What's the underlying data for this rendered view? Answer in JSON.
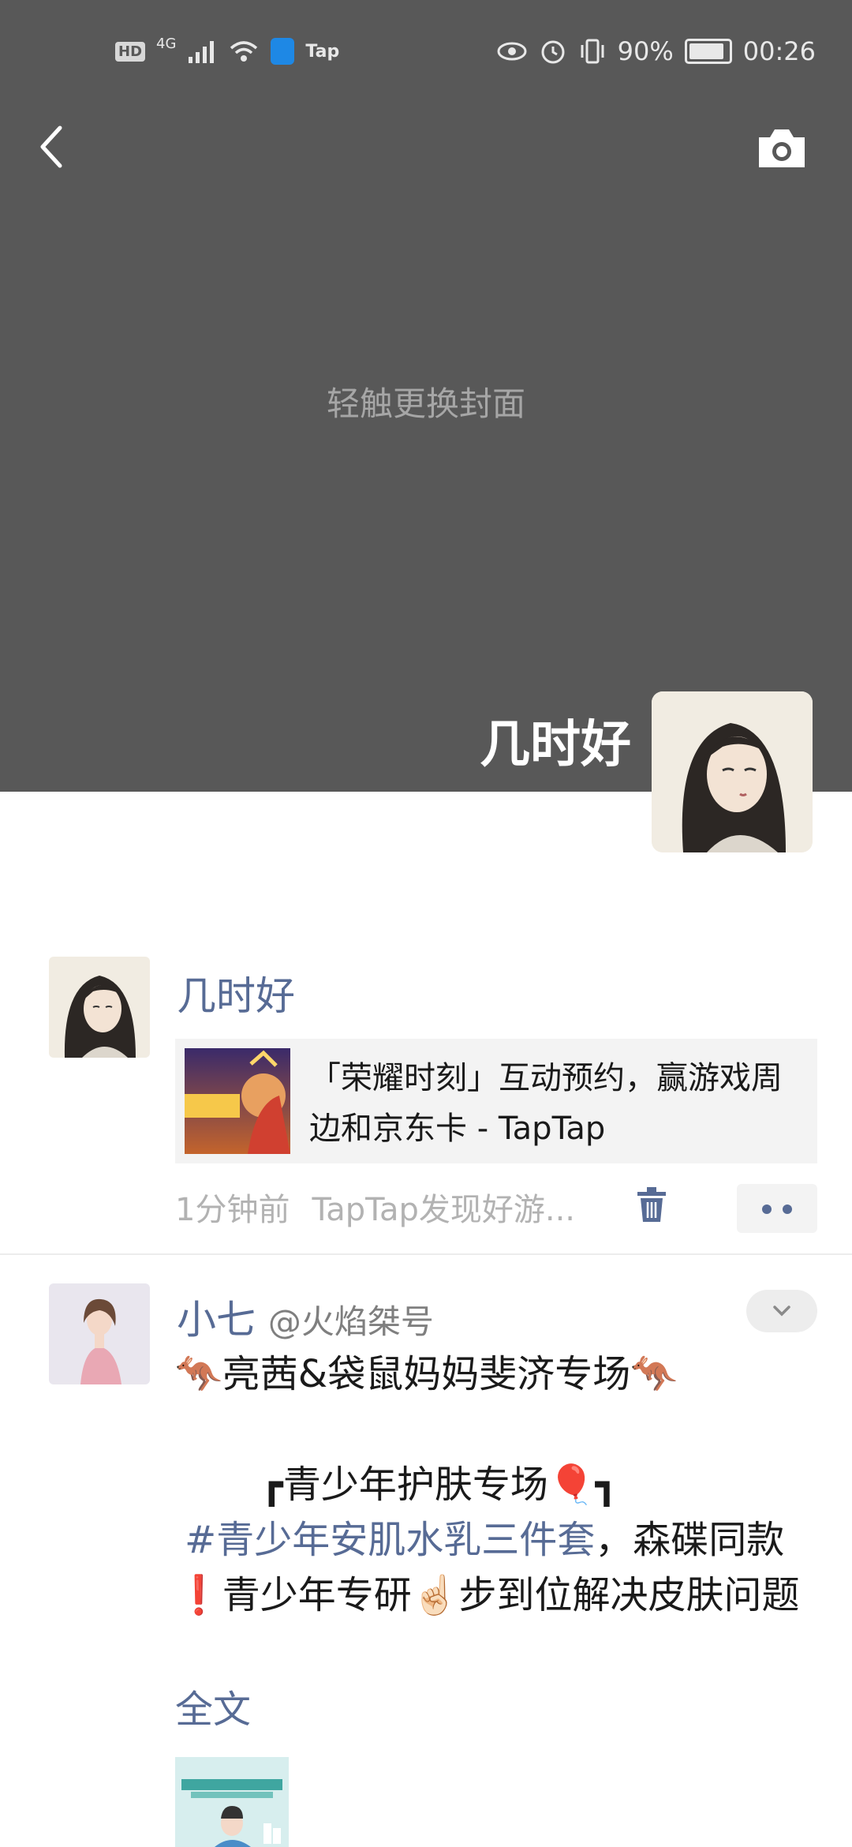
{
  "status_bar": {
    "hd": "HD",
    "network": "4G",
    "tap": "Tap",
    "battery": "90%",
    "time": "00:26"
  },
  "cover": {
    "hint": "轻触更换封面"
  },
  "profile": {
    "name": "几时好"
  },
  "posts": [
    {
      "author": "几时好",
      "link_title": "「荣耀时刻」互动预约，赢游戏周边和京东卡 - TapTap",
      "time": "1分钟前",
      "app": "TapTap发现好游..."
    },
    {
      "author": "小七",
      "handle": "@火焰桀号",
      "line1": "🦘亮茜&袋鼠妈妈斐济专场🦘",
      "line2": "┏青少年护肤专场🎈┓",
      "hashtag": "#青少年安肌水乳三件套",
      "line3_rest": "，森碟同款❗青少年专研☝🏻步到位解决皮肤问题",
      "full_text": "全文"
    }
  ]
}
